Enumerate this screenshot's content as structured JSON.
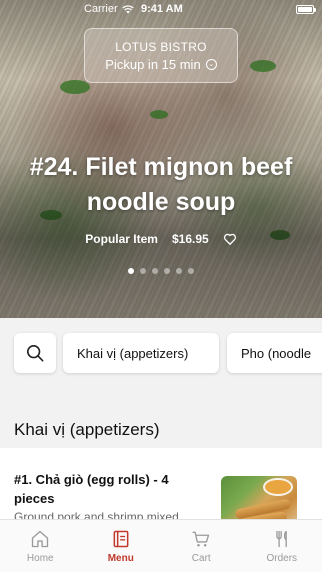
{
  "status_bar": {
    "carrier": "Carrier",
    "time": "9:41 AM"
  },
  "pickup": {
    "restaurant": "LOTUS BISTRO",
    "label": "Pickup in 15 min"
  },
  "hero": {
    "title": "#24. Filet mignon beef noodle soup",
    "badge": "Popular Item",
    "price": "$16.95",
    "carousel": {
      "count": 6,
      "active_index": 0
    }
  },
  "categories": {
    "items": [
      "Khai vị (appetizers)",
      "Pho (noodle"
    ]
  },
  "section": {
    "title": "Khai vị (appetizers)"
  },
  "menu_item": {
    "name": "#1. Chả giò (egg rolls) - 4 pieces",
    "description": "Ground pork and shrimp mixed"
  },
  "tabs": [
    {
      "label": "Home",
      "icon": "home-icon",
      "active": false
    },
    {
      "label": "Menu",
      "icon": "menu-icon",
      "active": true
    },
    {
      "label": "Cart",
      "icon": "cart-icon",
      "active": false
    },
    {
      "label": "Orders",
      "icon": "utensils-icon",
      "active": false
    }
  ],
  "colors": {
    "accent": "#c0392b",
    "inactive": "#9a9a9a"
  }
}
